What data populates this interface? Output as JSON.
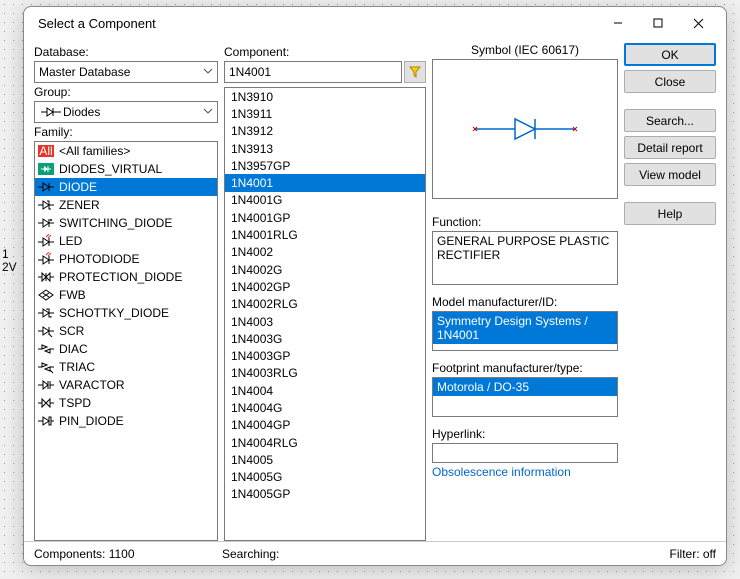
{
  "window": {
    "title": "Select a Component"
  },
  "background": {
    "line1": "1",
    "line2": "2V"
  },
  "left": {
    "database_label": "Database:",
    "database_value": "Master Database",
    "group_label": "Group:",
    "group_value": "Diodes",
    "family_label": "Family:",
    "families": [
      {
        "label": "<All families>",
        "icon": "all",
        "selected": false
      },
      {
        "label": "DIODES_VIRTUAL",
        "icon": "virtual",
        "selected": false
      },
      {
        "label": "DIODE",
        "icon": "diode",
        "selected": true
      },
      {
        "label": "ZENER",
        "icon": "zener",
        "selected": false
      },
      {
        "label": "SWITCHING_DIODE",
        "icon": "switching",
        "selected": false
      },
      {
        "label": "LED",
        "icon": "led",
        "selected": false
      },
      {
        "label": "PHOTODIODE",
        "icon": "photodiode",
        "selected": false
      },
      {
        "label": "PROTECTION_DIODE",
        "icon": "protection",
        "selected": false
      },
      {
        "label": "FWB",
        "icon": "fwb",
        "selected": false
      },
      {
        "label": "SCHOTTKY_DIODE",
        "icon": "schottky",
        "selected": false
      },
      {
        "label": "SCR",
        "icon": "scr",
        "selected": false
      },
      {
        "label": "DIAC",
        "icon": "diac",
        "selected": false
      },
      {
        "label": "TRIAC",
        "icon": "triac",
        "selected": false
      },
      {
        "label": "VARACTOR",
        "icon": "varactor",
        "selected": false
      },
      {
        "label": "TSPD",
        "icon": "tspd",
        "selected": false
      },
      {
        "label": "PIN_DIODE",
        "icon": "pin",
        "selected": false
      }
    ]
  },
  "center": {
    "component_label": "Component:",
    "component_value": "1N4001",
    "items": [
      "1N3910",
      "1N3911",
      "1N3912",
      "1N3913",
      "1N3957GP",
      "1N4001",
      "1N4001G",
      "1N4001GP",
      "1N4001RLG",
      "1N4002",
      "1N4002G",
      "1N4002GP",
      "1N4002RLG",
      "1N4003",
      "1N4003G",
      "1N4003GP",
      "1N4003RLG",
      "1N4004",
      "1N4004G",
      "1N4004GP",
      "1N4004RLG",
      "1N4005",
      "1N4005G",
      "1N4005GP"
    ],
    "selected": "1N4001"
  },
  "right": {
    "symbol_label": "Symbol (IEC 60617)",
    "function_label": "Function:",
    "function_value": "GENERAL PURPOSE PLASTIC RECTIFIER",
    "model_label": "Model manufacturer/ID:",
    "model_value": "Symmetry Design Systems / 1N4001",
    "footprint_label": "Footprint manufacturer/type:",
    "footprint_value": "Motorola / DO-35",
    "hyperlink_label": "Hyperlink:",
    "obsolescence_link": "Obsolescence information"
  },
  "buttons": {
    "ok": "OK",
    "close": "Close",
    "search": "Search...",
    "detail": "Detail report",
    "view_model": "View model",
    "help": "Help"
  },
  "status": {
    "components_label": "Components:",
    "components_count": "1100",
    "searching_label": "Searching:",
    "filter_label": "Filter:",
    "filter_value": "off"
  },
  "icons": {
    "all": "<rect x='1' y='1' width='16' height='12' fill='#e8342b'/><text x='9' y='11' font-size='9' fill='#fff' text-anchor='middle' font-family=\"Segoe UI\">All</text>",
    "virtual": "<rect x='1' y='1' width='16' height='12' fill='#0aa07a'/><line x1='4' y1='7' x2='7' y2='7' stroke='#fff'/><path d='M7 4 L7 10 L11 7 Z' fill='#fff'/><line x1='11' y1='4' x2='11' y2='10' stroke='#fff'/><line x1='11' y1='7' x2='14' y2='7' stroke='#fff'/>",
    "diode": "<line x1='1' y1='7' x2='6' y2='7' stroke='#000'/><path d='M6 3 L6 11 L12 7 Z' fill='none' stroke='#000'/><line x1='12' y1='3' x2='12' y2='11' stroke='#000'/><line x1='12' y1='7' x2='17' y2='7' stroke='#000'/>",
    "zener": "<line x1='1' y1='7' x2='6' y2='7' stroke='#000'/><path d='M6 3 L6 11 L12 7 Z' fill='none' stroke='#000'/><path d='M10 3 L12 3 L12 11 L14 11' fill='none' stroke='#000'/><line x1='12' y1='7' x2='17' y2='7' stroke='#000'/>",
    "switching": "<line x1='1' y1='7' x2='6' y2='7' stroke='#000'/><path d='M6 3 L6 11 L12 7 Z' fill='none' stroke='#000'/><line x1='12' y1='3' x2='12' y2='11' stroke='#000'/><line x1='12' y1='7' x2='17' y2='7' stroke='#000'/><circle cx='14' cy='4' r='1' fill='#000'/>",
    "led": "<line x1='1' y1='8' x2='6' y2='8' stroke='#000'/><path d='M6 4 L6 12 L12 8 Z' fill='none' stroke='#000'/><line x1='12' y1='4' x2='12' y2='12' stroke='#000'/><line x1='12' y1='8' x2='17' y2='8' stroke='#000'/><path d='M9 3 L12 0 M11 4 L14 1' stroke='#e8342b'/>",
    "photodiode": "<line x1='1' y1='8' x2='6' y2='8' stroke='#000'/><path d='M6 4 L6 12 L12 8 Z' fill='none' stroke='#000'/><line x1='12' y1='4' x2='12' y2='12' stroke='#000'/><line x1='12' y1='8' x2='17' y2='8' stroke='#000'/><path d='M12 0 L9 3 M14 1 L11 4' stroke='#e8342b'/>",
    "protection": "<line x1='1' y1='7' x2='5' y2='7' stroke='#000'/><path d='M5 3 L5 11 L9 7 Z' fill='none' stroke='#000'/><path d='M13 3 L13 11 L9 7 Z' fill='none' stroke='#000'/><line x1='9' y1='3' x2='9' y2='11' stroke='#000'/><line x1='13' y1='7' x2='17' y2='7' stroke='#000'/>",
    "fwb": "<path d='M9 2 L16 7 L9 12 L2 7 Z' fill='none' stroke='#000'/><line x1='6' y1='5' x2='12' y2='9' stroke='#000'/><line x1='12' y1='5' x2='6' y2='9' stroke='#000'/>",
    "schottky": "<line x1='1' y1='7' x2='6' y2='7' stroke='#000'/><path d='M6 3 L6 11 L12 7 Z' fill='none' stroke='#000'/><path d='M10 4 L10 3 L12 3 L12 11 L14 11 L14 10' fill='none' stroke='#000'/><line x1='12' y1='7' x2='17' y2='7' stroke='#000'/>",
    "scr": "<line x1='1' y1='7' x2='6' y2='7' stroke='#000'/><path d='M6 3 L6 11 L12 7 Z' fill='none' stroke='#000'/><line x1='12' y1='3' x2='12' y2='11' stroke='#000'/><line x1='12' y1='7' x2='17' y2='7' stroke='#000'/><line x1='12' y1='10' x2='15' y2='13' stroke='#000'/>",
    "diac": "<line x1='1' y1='7' x2='5' y2='7' stroke='#000'/><path d='M5 3 L5 7 L10 5 Z' fill='none' stroke='#000'/><path d='M13 7 L13 11 L8 9 Z' fill='none' stroke='#000'/><line x1='13' y1='7' x2='17' y2='7' stroke='#000'/>",
    "triac": "<line x1='1' y1='7' x2='5' y2='7' stroke='#000'/><path d='M5 3 L5 7 L10 5 Z' fill='none' stroke='#000'/><path d='M13 7 L13 11 L8 9 Z' fill='none' stroke='#000'/><line x1='13' y1='7' x2='17' y2='7' stroke='#000'/><line x1='13' y1='10' x2='16' y2='13' stroke='#000'/>",
    "varactor": "<line x1='1' y1='7' x2='6' y2='7' stroke='#000'/><path d='M6 3 L6 11 L11 7 Z' fill='none' stroke='#000'/><line x1='11' y1='3' x2='11' y2='11' stroke='#000'/><line x1='13' y1='3' x2='13' y2='11' stroke='#000'/><line x1='13' y1='7' x2='17' y2='7' stroke='#000'/>",
    "tspd": "<line x1='1' y1='7' x2='5' y2='7' stroke='#000'/><path d='M5 3 L5 11 L9 7 Z' fill='none' stroke='#000'/><path d='M13 3 L13 11 L9 7 Z' fill='none' stroke='#000'/><line x1='13' y1='7' x2='17' y2='7' stroke='#000'/>",
    "pin": "<line x1='1' y1='7' x2='6' y2='7' stroke='#000'/><path d='M6 3 L6 11 L12 7 Z' fill='none' stroke='#000'/><rect x='12' y='3' width='2' height='8' fill='none' stroke='#000'/><line x1='14' y1='7' x2='17' y2='7' stroke='#000'/>"
  }
}
